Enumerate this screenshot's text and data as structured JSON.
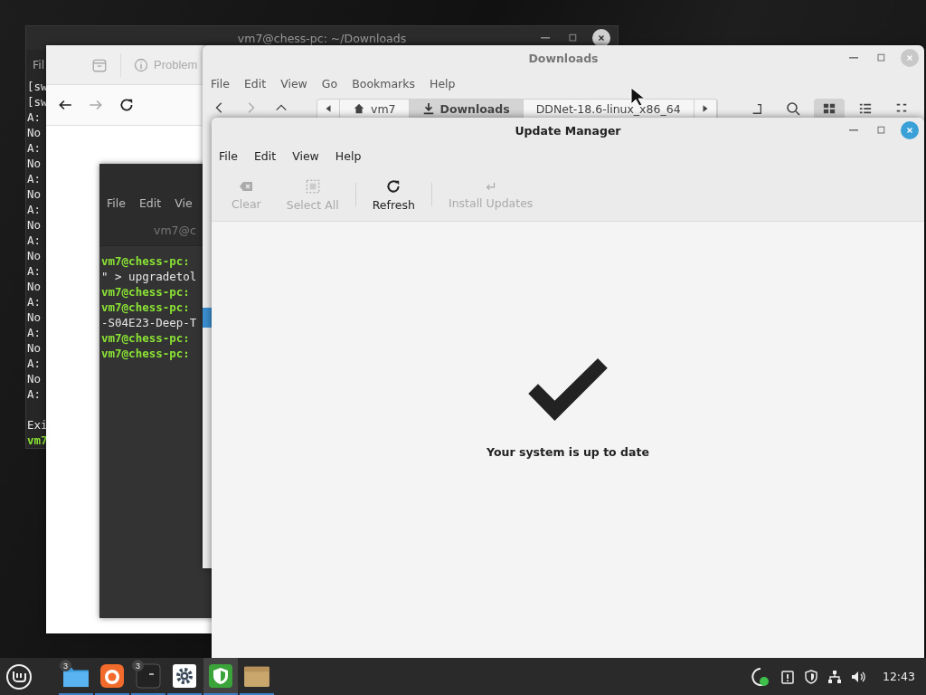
{
  "back_terminal": {
    "title": "vm7@chess-pc: ~/Downloads",
    "focused": false,
    "menu": [
      "Fil"
    ],
    "lines": [
      {
        "text": "[sw",
        "kind": "output"
      },
      {
        "text": "[sw",
        "kind": "output"
      },
      {
        "text": "A:",
        "kind": "output"
      },
      {
        "text": "No",
        "kind": "output"
      },
      {
        "text": "A:",
        "kind": "output"
      },
      {
        "text": "No",
        "kind": "output"
      },
      {
        "text": "A:",
        "kind": "output"
      },
      {
        "text": "No",
        "kind": "output"
      },
      {
        "text": "A:",
        "kind": "output"
      },
      {
        "text": "No",
        "kind": "output"
      },
      {
        "text": "A:",
        "kind": "output"
      },
      {
        "text": "No",
        "kind": "output"
      },
      {
        "text": "A:",
        "kind": "output"
      },
      {
        "text": "No",
        "kind": "output"
      },
      {
        "text": "A:",
        "kind": "output"
      },
      {
        "text": "No",
        "kind": "output"
      },
      {
        "text": "A:",
        "kind": "output"
      },
      {
        "text": "No",
        "kind": "output"
      },
      {
        "text": "A:",
        "kind": "output"
      },
      {
        "text": "No",
        "kind": "output"
      },
      {
        "text": "A:",
        "kind": "output"
      }
    ],
    "after_lines": [
      {
        "text": "Exi",
        "kind": "output"
      },
      {
        "text": "vm7",
        "kind": "prompt"
      }
    ]
  },
  "browser": {
    "tab_label": "Problem"
  },
  "small_terminal": {
    "menu": [
      "File",
      "Edit",
      "Vie"
    ],
    "title": "vm7@c",
    "lines": [
      {
        "text": "vm7@chess-pc:",
        "kind": "prompt"
      },
      {
        "text": "\" > upgradetol",
        "kind": "output"
      },
      {
        "text": "vm7@chess-pc:",
        "kind": "prompt"
      },
      {
        "text": "vm7@chess-pc:",
        "kind": "prompt"
      },
      {
        "text": "-S04E23-Deep-T",
        "kind": "output"
      },
      {
        "text": "vm7@chess-pc:",
        "kind": "prompt"
      },
      {
        "text": "vm7@chess-pc:",
        "kind": "prompt"
      }
    ]
  },
  "file_manager": {
    "title": "Downloads",
    "focused": false,
    "menu": [
      "File",
      "Edit",
      "View",
      "Go",
      "Bookmarks",
      "Help"
    ],
    "path": [
      {
        "label": "vm7",
        "kind": "home",
        "selected": false
      },
      {
        "label": "Downloads",
        "kind": "download",
        "selected": true
      },
      {
        "label": "DDNet-18.6-linux_x86_64",
        "kind": "folder",
        "selected": false
      }
    ],
    "view_modes": [
      {
        "kind": "grid",
        "selected": true
      },
      {
        "kind": "list",
        "selected": false
      },
      {
        "kind": "compact",
        "selected": false
      }
    ]
  },
  "update_manager": {
    "title": "Update Manager",
    "focused": true,
    "menu": [
      "File",
      "Edit",
      "View",
      "Help"
    ],
    "toolbar": [
      {
        "label": "Clear",
        "kind": "clear",
        "disabled": true
      },
      {
        "label": "Select All",
        "kind": "select-all",
        "disabled": true
      },
      {
        "label": "Refresh",
        "kind": "refresh",
        "disabled": false
      },
      {
        "label": "Install Updates",
        "kind": "install",
        "disabled": true
      }
    ],
    "status": "Your system is up to date"
  },
  "taskbar": {
    "apps": [
      {
        "kind": "files",
        "badge": "3",
        "active": false
      },
      {
        "kind": "browser",
        "active": false
      },
      {
        "kind": "terminal",
        "badge": "3",
        "active": false
      },
      {
        "kind": "settings",
        "active": false
      },
      {
        "kind": "shield",
        "active": true
      },
      {
        "kind": "archive",
        "active": false
      }
    ],
    "clock": "12:43"
  }
}
